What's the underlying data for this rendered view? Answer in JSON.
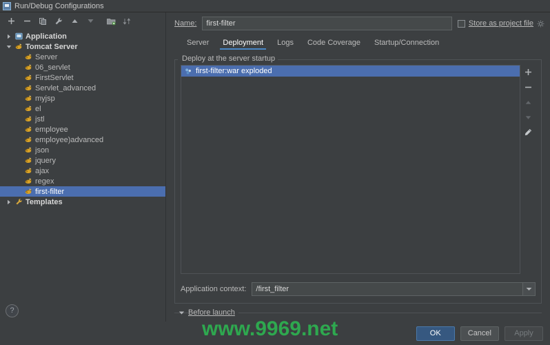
{
  "window": {
    "title": "Run/Debug Configurations",
    "icon": "run-debug-icon"
  },
  "toolbar": {
    "buttons": [
      {
        "name": "add-configuration-button",
        "icon": "plus-icon",
        "label": "+"
      },
      {
        "name": "remove-configuration-button",
        "icon": "minus-icon",
        "label": "−"
      },
      {
        "name": "copy-configuration-button",
        "icon": "copy-icon",
        "label": "copy"
      },
      {
        "name": "edit-templates-button",
        "icon": "wrench-icon",
        "label": "wrench"
      },
      {
        "name": "move-up-button",
        "icon": "arrow-up-icon",
        "label": "up"
      },
      {
        "name": "move-down-button",
        "icon": "arrow-down-icon",
        "label": "down"
      },
      {
        "name": "move-into-folder-button",
        "icon": "folder-icon",
        "label": "folder"
      },
      {
        "name": "sort-configurations-button",
        "icon": "sort-icon",
        "label": "sort"
      }
    ]
  },
  "tree": {
    "items": [
      {
        "label": "Application",
        "level": 0,
        "twisty": "collapsed",
        "icon": "application-icon",
        "bold": true,
        "selected": false
      },
      {
        "label": "Tomcat Server",
        "level": 0,
        "twisty": "expanded",
        "icon": "tomcat-icon",
        "bold": true,
        "selected": false
      },
      {
        "label": "Server",
        "level": 1,
        "twisty": "none",
        "icon": "tomcat-icon",
        "bold": false,
        "selected": false
      },
      {
        "label": "06_servlet",
        "level": 1,
        "twisty": "none",
        "icon": "tomcat-icon",
        "bold": false,
        "selected": false
      },
      {
        "label": "FirstServlet",
        "level": 1,
        "twisty": "none",
        "icon": "tomcat-icon",
        "bold": false,
        "selected": false
      },
      {
        "label": "Servlet_advanced",
        "level": 1,
        "twisty": "none",
        "icon": "tomcat-icon",
        "bold": false,
        "selected": false
      },
      {
        "label": "myjsp",
        "level": 1,
        "twisty": "none",
        "icon": "tomcat-icon",
        "bold": false,
        "selected": false
      },
      {
        "label": "el",
        "level": 1,
        "twisty": "none",
        "icon": "tomcat-icon",
        "bold": false,
        "selected": false
      },
      {
        "label": "jstl",
        "level": 1,
        "twisty": "none",
        "icon": "tomcat-icon",
        "bold": false,
        "selected": false
      },
      {
        "label": "employee",
        "level": 1,
        "twisty": "none",
        "icon": "tomcat-icon",
        "bold": false,
        "selected": false
      },
      {
        "label": "employee)advanced",
        "level": 1,
        "twisty": "none",
        "icon": "tomcat-icon",
        "bold": false,
        "selected": false
      },
      {
        "label": "json",
        "level": 1,
        "twisty": "none",
        "icon": "tomcat-icon",
        "bold": false,
        "selected": false
      },
      {
        "label": "jquery",
        "level": 1,
        "twisty": "none",
        "icon": "tomcat-icon",
        "bold": false,
        "selected": false
      },
      {
        "label": "ajax",
        "level": 1,
        "twisty": "none",
        "icon": "tomcat-icon",
        "bold": false,
        "selected": false
      },
      {
        "label": "regex",
        "level": 1,
        "twisty": "none",
        "icon": "tomcat-icon",
        "bold": false,
        "selected": false
      },
      {
        "label": "first-filter",
        "level": 1,
        "twisty": "none",
        "icon": "tomcat-icon",
        "bold": false,
        "selected": true
      },
      {
        "label": "Templates",
        "level": 0,
        "twisty": "collapsed",
        "icon": "wrench-icon",
        "bold": true,
        "selected": false
      }
    ]
  },
  "help": {
    "label": "?",
    "icon": "help-icon"
  },
  "name_row": {
    "label": "Name:",
    "value": "first-filter",
    "placeholder": "",
    "store_label": "Store as project file",
    "store_checked": false,
    "gear_icon": "gear-icon"
  },
  "tabs": [
    {
      "label": "Server",
      "active": false
    },
    {
      "label": "Deployment",
      "active": true
    },
    {
      "label": "Logs",
      "active": false
    },
    {
      "label": "Code Coverage",
      "active": false
    },
    {
      "label": "Startup/Connection",
      "active": false
    }
  ],
  "deployment": {
    "group_title": "Deploy at the server startup",
    "items": [
      {
        "label": "first-filter:war exploded",
        "selected": true,
        "icon": "artifact-icon"
      }
    ],
    "side_tools": [
      {
        "name": "add-artifact-button",
        "icon": "plus-icon"
      },
      {
        "name": "remove-artifact-button",
        "icon": "minus-icon"
      },
      {
        "name": "move-artifact-up-button",
        "icon": "arrow-up-icon"
      },
      {
        "name": "move-artifact-down-button",
        "icon": "arrow-down-icon"
      },
      {
        "name": "edit-artifact-button",
        "icon": "pencil-icon"
      }
    ],
    "context_label": "Application context:",
    "context_value": "/first_filter"
  },
  "before_launch": {
    "label": "Before launch",
    "expanded": true
  },
  "footer": {
    "ok_label": "OK",
    "cancel_label": "Cancel",
    "apply_label": "Apply",
    "apply_disabled": true
  },
  "watermark": {
    "text": "www.9969.net",
    "color": "#2ea84f"
  },
  "colors": {
    "background": "#3c3f41",
    "selection": "#4b6eaf",
    "accent": "#4a88c7",
    "primary_button": "#365880",
    "text": "#bbbbbb"
  }
}
